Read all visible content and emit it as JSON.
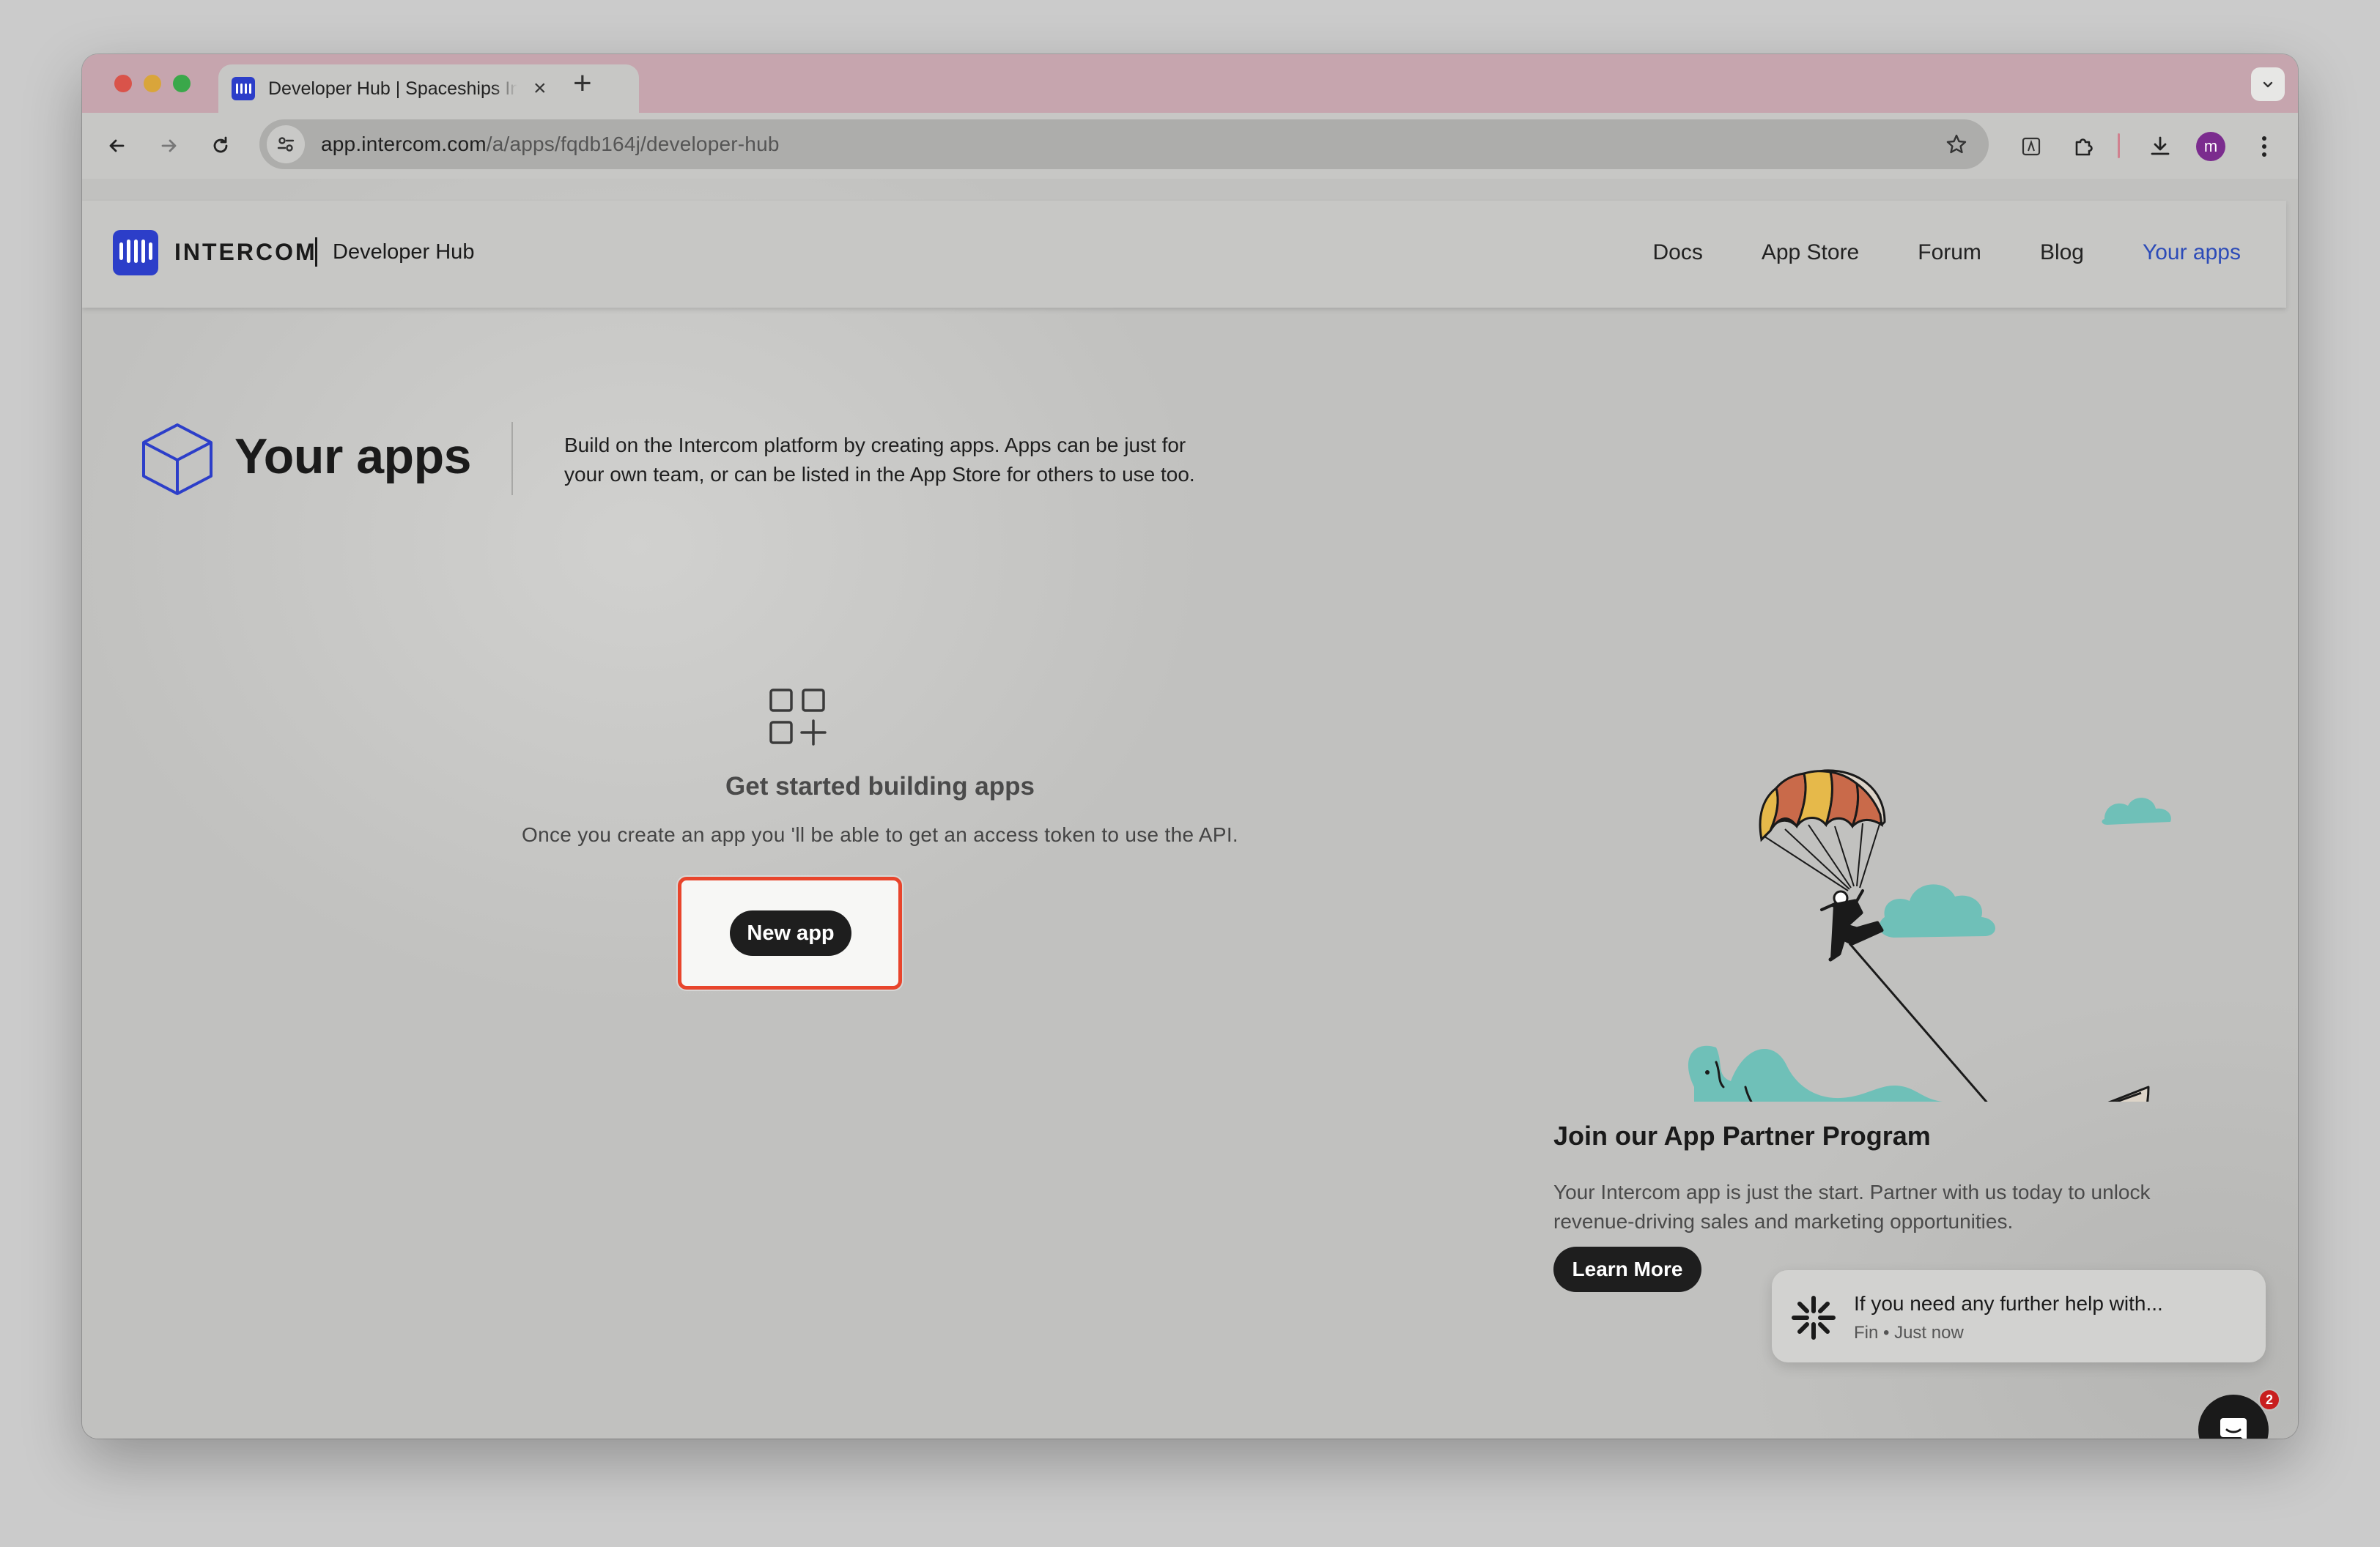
{
  "browser": {
    "tab_title": "Developer Hub | Spaceships Intercom",
    "url_host": "app.intercom.com",
    "url_path": "/a/apps/fqdb164j/developer-hub",
    "avatar_letter": "m"
  },
  "header": {
    "logo_text": "INTERCOM",
    "logo_sub": "Developer Hub",
    "nav": [
      {
        "label": "Docs"
      },
      {
        "label": "App Store"
      },
      {
        "label": "Forum"
      },
      {
        "label": "Blog"
      },
      {
        "label": "Your apps",
        "active": true
      }
    ]
  },
  "hero": {
    "title": "Your apps",
    "description_line1": "Build on the Intercom platform by creating apps. Apps can be just for",
    "description_line2": "your own team, or can be listed in the App Store for others to use too."
  },
  "empty_state": {
    "title": "Get started building apps",
    "description": "Once you create an app you 'll be able to get an access token to use the API.",
    "button_label": "New app"
  },
  "partner": {
    "title": "Join our App Partner Program",
    "description_line1": "Your Intercom app is just the start. Partner with us today to unlock",
    "description_line2": "revenue-driving sales and marketing opportunities.",
    "button_label": "Learn More"
  },
  "messenger": {
    "preview_text": "If you need any further help with...",
    "meta": "Fin • Just now",
    "badge_count": "2"
  },
  "colors": {
    "accent": "#2c4bb8",
    "brand": "#2c3ec9",
    "highlight": "#e8452c",
    "button": "#1e1e1e"
  }
}
